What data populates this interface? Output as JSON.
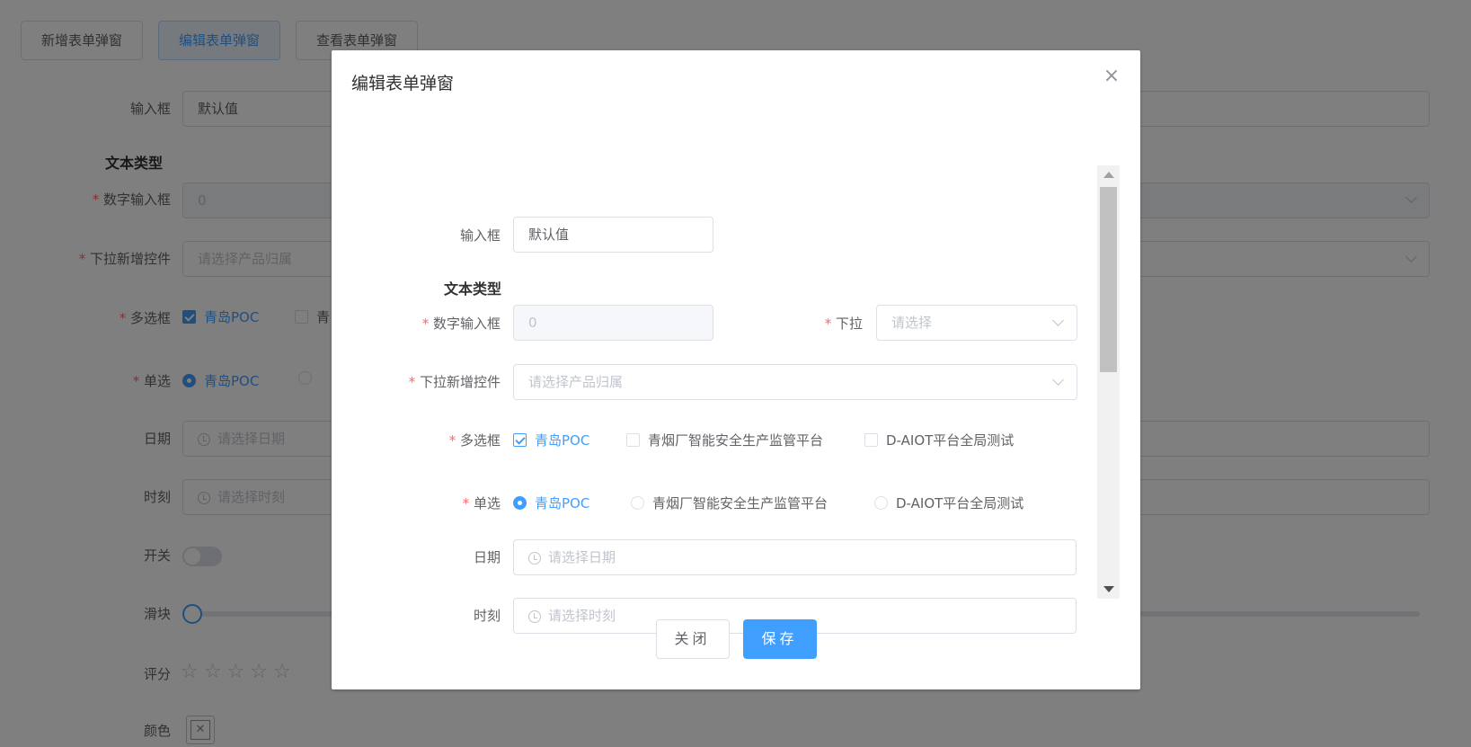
{
  "top_buttons": [
    "新增表单弹窗",
    "编辑表单弹窗",
    "查看表单弹窗"
  ],
  "form": {
    "input_label": "输入框",
    "input_value": "默认值",
    "section_title": "文本类型",
    "number_label": "数字输入框",
    "number_value": "0",
    "dropdown_add_label": "下拉新增控件",
    "dropdown_add_placeholder": "请选择产品归属",
    "checkbox_label": "多选框",
    "radio_label": "单选",
    "options": [
      "青岛POC",
      "青烟厂智能安全生产监管平台",
      "D-AIOT平台全局测试"
    ],
    "bg_truncated_option": "青",
    "date_label": "日期",
    "date_placeholder": "请选择日期",
    "time_label": "时刻",
    "time_placeholder": "请选择时刻",
    "switch_label": "开关",
    "slider_label": "滑块",
    "rate_label": "评分",
    "color_label": "颜色",
    "select_label": "下拉",
    "select_placeholder": "请选择"
  },
  "dialog": {
    "title": "编辑表单弹窗",
    "close_label": "关闭",
    "save_label": "保存"
  },
  "colors": {
    "primary": "#409eff",
    "required": "#f56c6c",
    "overlay": "rgba(0,0,0,0.5)"
  }
}
